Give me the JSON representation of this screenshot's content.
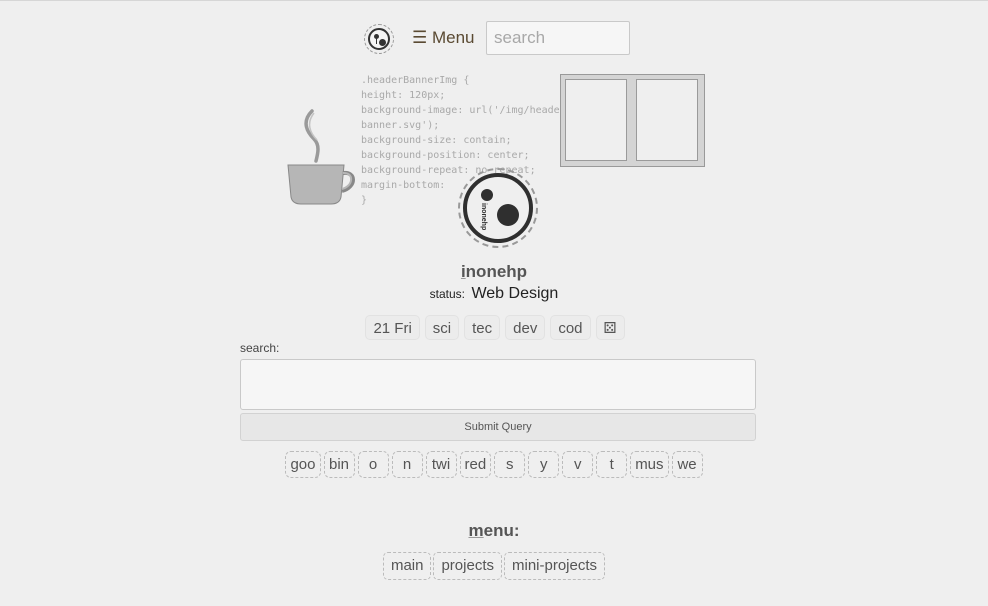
{
  "nav": {
    "menu_label": "☰ Menu",
    "search_placeholder": "search"
  },
  "banner": {
    "code_lines": [
      ".headerBannerImg {",
      "height: 120px;",
      "background-image: url('/img/header-",
      "banner.svg');",
      "background-size: contain;",
      "background-position: center;",
      "background-repeat: no-repeat;",
      "margin-bottom: ",
      "}"
    ]
  },
  "profile": {
    "logo_text": "inonehp",
    "username_first": "i",
    "username_rest": "nonehp",
    "status_label": "status:",
    "status_value": "Web Design"
  },
  "tags": [
    "21 Fri",
    "sci",
    "tec",
    "dev",
    "cod",
    "⚄"
  ],
  "search_form": {
    "label": "search:",
    "submit_label": "Submit Query"
  },
  "engines": [
    "goo",
    "bin",
    "o",
    "n",
    "twi",
    "red",
    "s",
    "y",
    "v",
    "t",
    "mus",
    "we"
  ],
  "menu": {
    "title_first": "m",
    "title_rest": "enu:",
    "links": [
      "main",
      "projects",
      "mini-projects"
    ]
  }
}
